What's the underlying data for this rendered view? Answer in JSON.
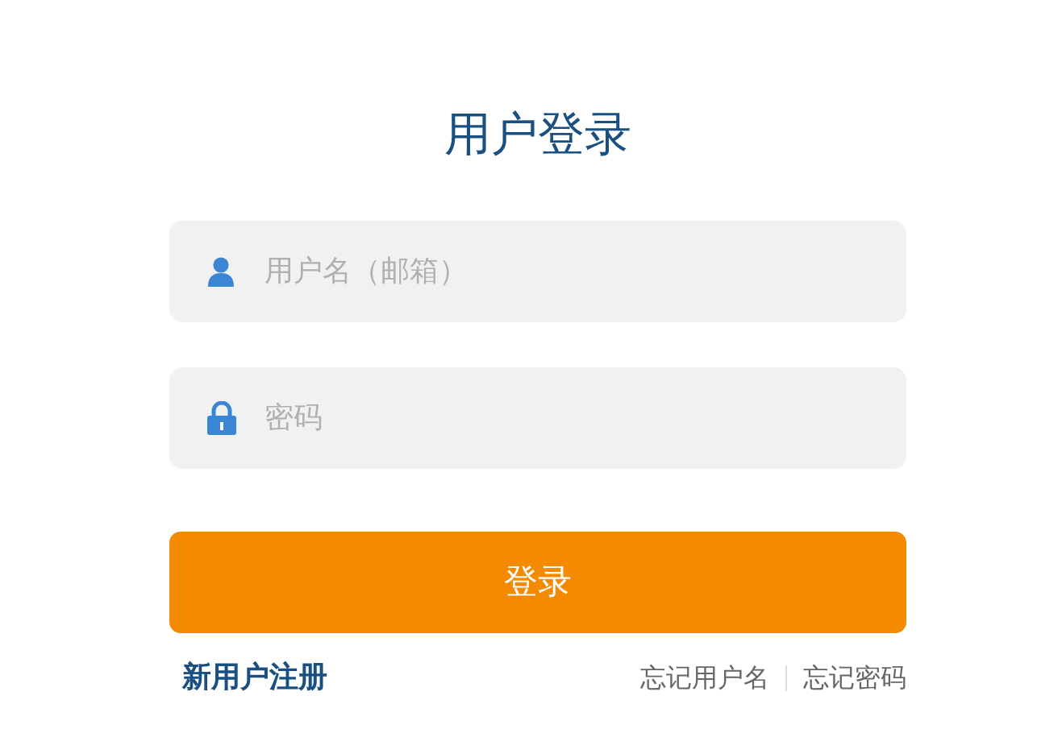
{
  "title": "用户登录",
  "fields": [
    {
      "kind": "username",
      "placeholder": "用户名（邮箱）"
    },
    {
      "kind": "password",
      "placeholder": "密码"
    }
  ],
  "submit": "登录",
  "register_link": "新用户注册",
  "help_links": [
    "忘记用户名",
    "忘记密码"
  ]
}
